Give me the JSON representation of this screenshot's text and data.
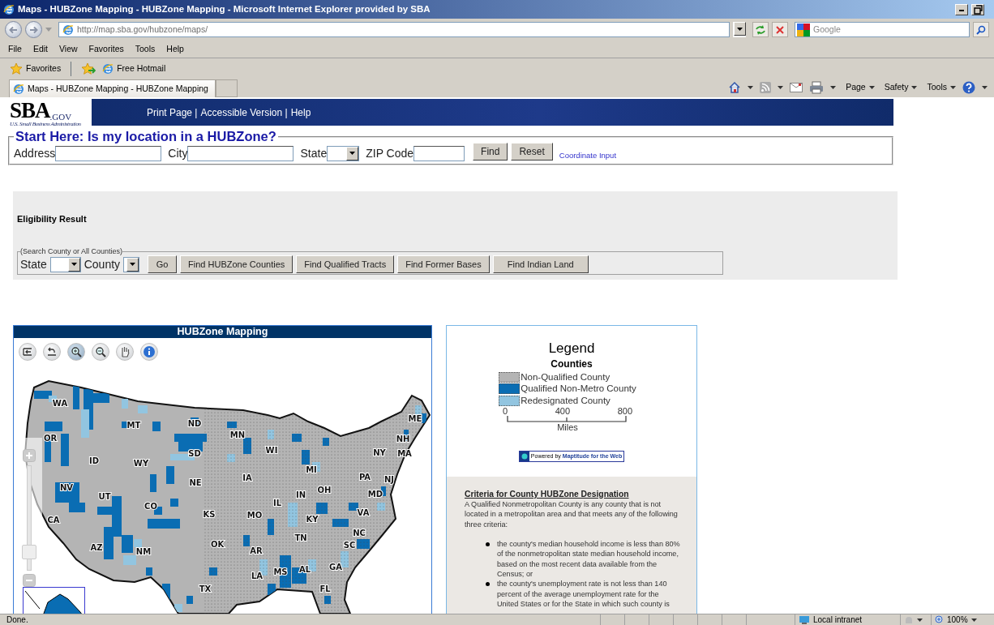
{
  "window": {
    "title": "Maps - HUBZone Mapping - HUBZone Mapping - Microsoft Internet Explorer provided by SBA"
  },
  "address_bar": {
    "url": "http://map.sba.gov/hubzone/maps/"
  },
  "search_box": {
    "placeholder": "Google"
  },
  "menu_bar": [
    "File",
    "Edit",
    "View",
    "Favorites",
    "Tools",
    "Help"
  ],
  "favorites_bar": {
    "label": "Favorites",
    "links": [
      "Free Hotmail"
    ]
  },
  "tabs": [
    {
      "label": "Maps - HUBZone Mapping - HUBZone Mapping",
      "selected": true
    }
  ],
  "command_bar": [
    "Page",
    "Safety",
    "Tools"
  ],
  "site_header": {
    "logo": {
      "mark": "SBA",
      "suffix": ".GOV",
      "tagline": "U.S. Small Business Administration"
    },
    "links": [
      "Print Page |",
      "Accessible Version |",
      "Help"
    ]
  },
  "location_search": {
    "legend": "Start Here: Is my location in a HUBZone?",
    "fields": [
      {
        "label": "Address",
        "kind": "text"
      },
      {
        "label": "City",
        "kind": "text"
      },
      {
        "label": "State",
        "kind": "select"
      },
      {
        "label": "ZIP Code",
        "kind": "text"
      }
    ],
    "buttons": [
      "Find",
      "Reset"
    ],
    "link": "Coordinate Input"
  },
  "eligibility": {
    "heading": "Eligibility Result"
  },
  "county_search": {
    "legend": "(Search County or All Counties)",
    "fields": [
      {
        "label": "State",
        "kind": "select"
      },
      {
        "label": "County",
        "kind": "select"
      }
    ],
    "buttons": [
      "Go",
      "Find HUBZone Counties",
      "Find Qualified Tracts",
      "Find Former Bases",
      "Find Indian Land"
    ]
  },
  "map_panel": {
    "title": "HUBZone Mapping",
    "tools": [
      {
        "kind": "full-extent",
        "selected": false
      },
      {
        "kind": "previous",
        "selected": false
      },
      {
        "kind": "zoom-in",
        "selected": true
      },
      {
        "kind": "zoom-out",
        "selected": false
      },
      {
        "kind": "pan",
        "selected": false
      },
      {
        "kind": "info",
        "selected": false
      }
    ],
    "zoom_slider": {
      "level": 0.12
    },
    "state_labels": [
      "WA",
      "OR",
      "MT",
      "ND",
      "MN",
      "SD",
      "ID",
      "WY",
      "WI",
      "MI",
      "NY",
      "ME",
      "NH",
      "MA",
      "NV",
      "UT",
      "CO",
      "NE",
      "IA",
      "IL",
      "IN",
      "OH",
      "PA",
      "NJ",
      "MD",
      "CA",
      "KS",
      "MO",
      "KY",
      "VA",
      "AZ",
      "NM",
      "OK",
      "AR",
      "TN",
      "NC",
      "SC",
      "TX",
      "LA",
      "MS",
      "AL",
      "GA",
      "FL"
    ]
  },
  "legend": {
    "title": "Legend",
    "layer": "Counties",
    "items": [
      {
        "label": "Non-Qualified County",
        "color": "#b4b4b4"
      },
      {
        "label": "Qualified Non-Metro County",
        "color": "#0a6db3"
      },
      {
        "label": "Redesignated County",
        "color": "#92c5e0"
      }
    ],
    "scale": {
      "ticks": [
        "0",
        "400",
        "800"
      ],
      "unit": "Miles"
    },
    "credit": {
      "prefix": "Powered by",
      "product": "Maptitude for the Web"
    }
  },
  "criteria": {
    "heading": "Criteria for County HUBZone Designation",
    "intro": "A Qualified Nonmetropolitan County is any county that is not located in a metropolitan area and that meets any of the following three criteria:",
    "bullets": [
      "the county's median household income is less than 80% of the nonmetropolitan state median household income, based on the most recent data available from the Census; or",
      "the county's unemployment rate is not less than 140 percent of the average unemployment rate for the United States or for the State in which such county is"
    ]
  },
  "status_bar": {
    "text": "Done.",
    "zone": "Local intranet",
    "zoom": "100%"
  }
}
